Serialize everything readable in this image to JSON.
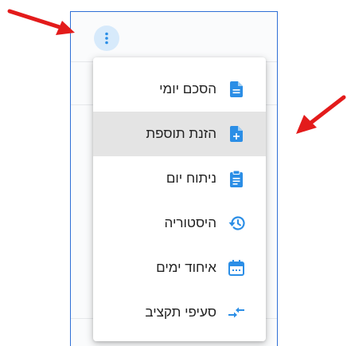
{
  "menu": {
    "items": [
      {
        "label": "הסכם יומי",
        "icon": "file-text-icon"
      },
      {
        "label": "הזנת תוספת",
        "icon": "file-plus-icon"
      },
      {
        "label": "ניתוח יום",
        "icon": "clipboard-list-icon"
      },
      {
        "label": "היסטוריה",
        "icon": "history-icon"
      },
      {
        "label": "איחוד ימים",
        "icon": "calendar-icon"
      },
      {
        "label": "סעיפי תקציב",
        "icon": "arrows-merge-icon"
      }
    ],
    "highlighted_index": 1
  },
  "colors": {
    "icon": "#2b8ee6",
    "kebab_bg": "#d7eafb",
    "frame_border": "#2f6fd6",
    "annotation_arrow": "#e31b1b",
    "highlight": "#e4e4e4"
  }
}
